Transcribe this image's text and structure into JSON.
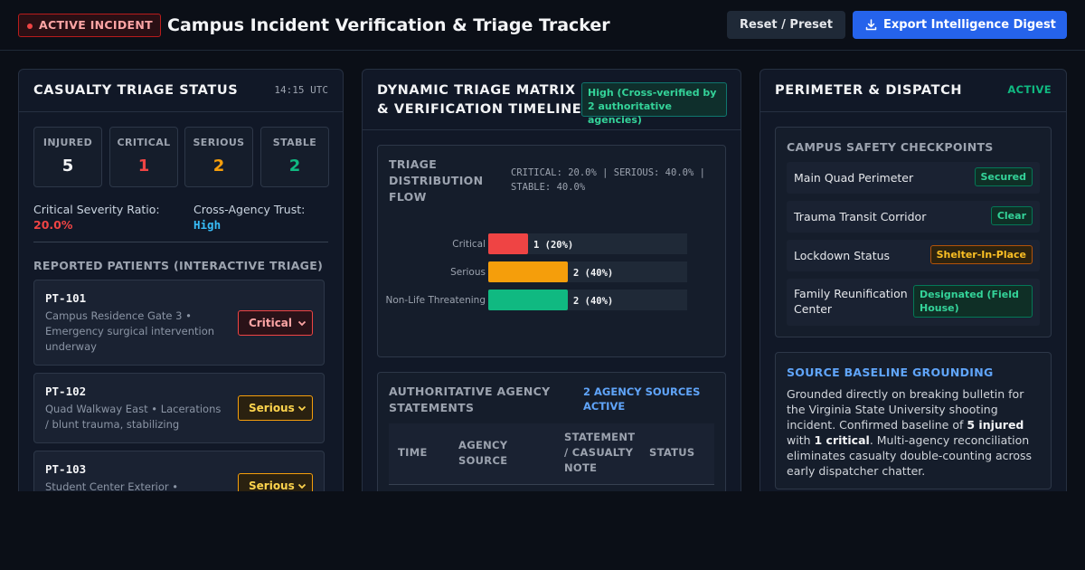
{
  "header": {
    "incident_badge": "ACTIVE INCIDENT",
    "title": "Campus Incident Verification & Triage Tracker",
    "reset_label": "Reset / Preset",
    "export_label": "Export Intelligence Digest"
  },
  "casualty": {
    "title": "CASUALTY TRIAGE STATUS",
    "time": "14:15 UTC",
    "stats": [
      {
        "label": "INJURED",
        "value": "5",
        "color": "#f3f4f6"
      },
      {
        "label": "CRITICAL",
        "value": "1",
        "color": "#ef4444"
      },
      {
        "label": "SERIOUS",
        "value": "2",
        "color": "#f59e0b"
      },
      {
        "label": "STABLE",
        "value": "2",
        "color": "#10b981"
      }
    ],
    "ratio_label": "Critical Severity Ratio:",
    "ratio_value": "20.0%",
    "trust_label": "Cross-Agency Trust:",
    "trust_value": "High",
    "patients_title": "REPORTED PATIENTS (INTERACTIVE TRIAGE)",
    "patients": [
      {
        "id": "PT-101",
        "desc": "Campus Residence Gate 3 • Emergency surgical intervention underway",
        "triage": "Critical"
      },
      {
        "id": "PT-102",
        "desc": "Quad Walkway East • Lacerations / blunt trauma, stabilizing",
        "triage": "Serious"
      },
      {
        "id": "PT-103",
        "desc": "Student Center Exterior •",
        "triage": "Serious"
      }
    ]
  },
  "matrix": {
    "title_line1": "DYNAMIC TRIAGE MATRIX",
    "title_line2": "& VERIFICATION TIMELINE",
    "confidence": "High (Cross-verified by 2 authoritative agencies)",
    "chart_title": "TRIAGE DISTRIBUTION FLOW",
    "chart_summary": "CRITICAL: 20.0% | SERIOUS: 40.0% | STABLE: 40.0%",
    "agency_title": "AUTHORITATIVE AGENCY STATEMENTS",
    "agency_count": "2 AGENCY SOURCES ACTIVE",
    "table_headers": [
      "TIME",
      "AGENCY SOURCE",
      "STATEMENT / CASUALTY NOTE",
      "STATUS"
    ]
  },
  "chart_data": {
    "type": "bar",
    "orientation": "horizontal",
    "categories": [
      "Critical",
      "Serious",
      "Non-Life Threatening"
    ],
    "values": [
      1,
      2,
      2
    ],
    "data_labels": [
      "1 (20%)",
      "2 (40%)",
      "2 (40%)"
    ],
    "colors": [
      "#ef4444",
      "#f59e0b",
      "#10b981"
    ],
    "xlim": [
      0,
      5
    ],
    "title": "TRIAGE DISTRIBUTION FLOW"
  },
  "perimeter": {
    "title": "PERIMETER & DISPATCH",
    "status": "ACTIVE",
    "checkpoints_title": "CAMPUS SAFETY CHECKPOINTS",
    "checkpoints": [
      {
        "name": "Main Quad Perimeter",
        "status": "Secured",
        "tone": "green"
      },
      {
        "name": "Trauma Transit Corridor",
        "status": "Clear",
        "tone": "green"
      },
      {
        "name": "Lockdown Status",
        "status": "Shelter-In-Place",
        "tone": "amber"
      },
      {
        "name": "Family Reunification Center",
        "status": "Designated (Field House)",
        "tone": "green"
      }
    ],
    "grounding_title": "SOURCE BASELINE GROUNDING",
    "grounding_text_1": "Grounded directly on breaking bulletin for the Virginia State University shooting incident. Confirmed baseline of ",
    "grounding_bold_1": "5 injured",
    "grounding_text_2": " with ",
    "grounding_bold_2": "1 critical",
    "grounding_text_3": ". Multi-agency reconciliation eliminates casualty double-counting across early dispatcher chatter."
  }
}
